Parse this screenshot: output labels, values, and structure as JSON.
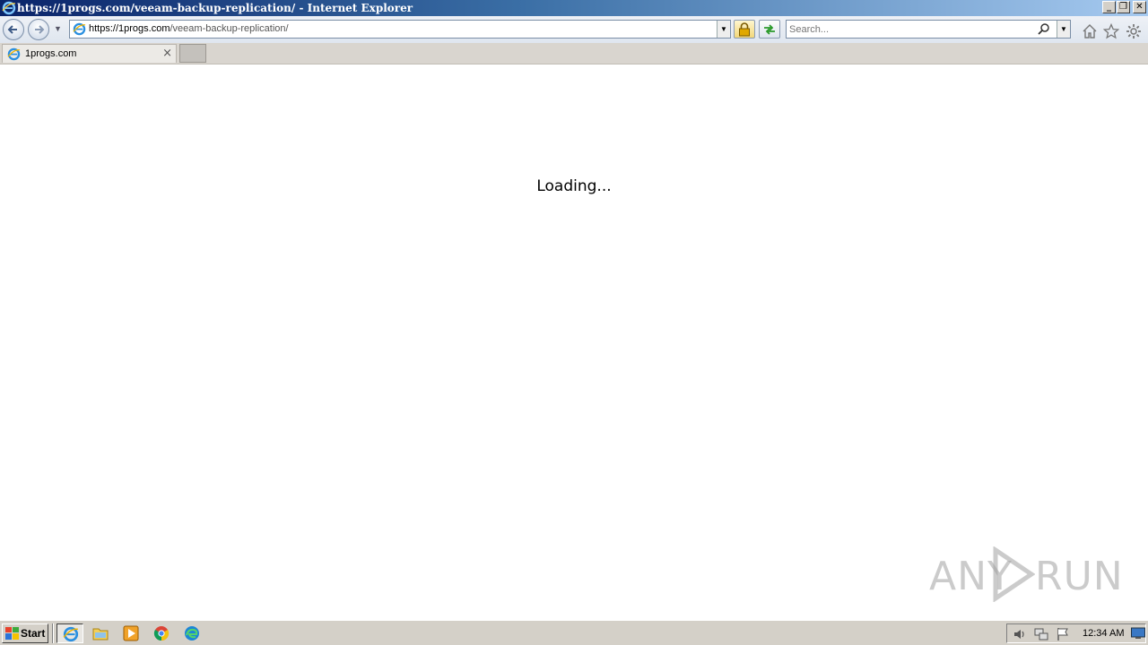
{
  "window": {
    "title": "https://1progs.com/veeam-backup-replication/ - Internet Explorer"
  },
  "navbar": {
    "address": {
      "url_host": "https://1progs.com",
      "url_path": "/veeam-backup-replication/"
    },
    "search": {
      "placeholder": "Search..."
    }
  },
  "tabs": [
    {
      "label": "1progs.com",
      "close_label": "×"
    }
  ],
  "content": {
    "loading_text": "Loading..."
  },
  "watermark": {
    "left": "ANY",
    "right": "RUN"
  },
  "taskbar": {
    "start_label": "Start",
    "clock": "12:34 AM"
  }
}
